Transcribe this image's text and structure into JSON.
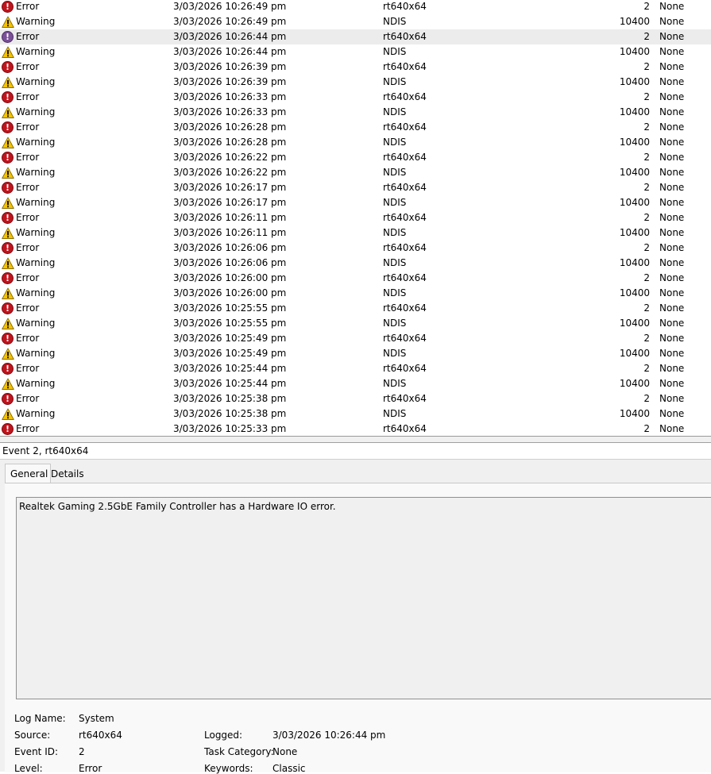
{
  "events": [
    {
      "level": "Error",
      "date": "3/03/2026 10:26:49 pm",
      "source": "rt640x64",
      "event_id": "2",
      "task": "None"
    },
    {
      "level": "Warning",
      "date": "3/03/2026 10:26:49 pm",
      "source": "NDIS",
      "event_id": "10400",
      "task": "None"
    },
    {
      "level": "Error",
      "date": "3/03/2026 10:26:44 pm",
      "source": "rt640x64",
      "event_id": "2",
      "task": "None",
      "selected": true
    },
    {
      "level": "Warning",
      "date": "3/03/2026 10:26:44 pm",
      "source": "NDIS",
      "event_id": "10400",
      "task": "None"
    },
    {
      "level": "Error",
      "date": "3/03/2026 10:26:39 pm",
      "source": "rt640x64",
      "event_id": "2",
      "task": "None"
    },
    {
      "level": "Warning",
      "date": "3/03/2026 10:26:39 pm",
      "source": "NDIS",
      "event_id": "10400",
      "task": "None"
    },
    {
      "level": "Error",
      "date": "3/03/2026 10:26:33 pm",
      "source": "rt640x64",
      "event_id": "2",
      "task": "None"
    },
    {
      "level": "Warning",
      "date": "3/03/2026 10:26:33 pm",
      "source": "NDIS",
      "event_id": "10400",
      "task": "None"
    },
    {
      "level": "Error",
      "date": "3/03/2026 10:26:28 pm",
      "source": "rt640x64",
      "event_id": "2",
      "task": "None"
    },
    {
      "level": "Warning",
      "date": "3/03/2026 10:26:28 pm",
      "source": "NDIS",
      "event_id": "10400",
      "task": "None"
    },
    {
      "level": "Error",
      "date": "3/03/2026 10:26:22 pm",
      "source": "rt640x64",
      "event_id": "2",
      "task": "None"
    },
    {
      "level": "Warning",
      "date": "3/03/2026 10:26:22 pm",
      "source": "NDIS",
      "event_id": "10400",
      "task": "None"
    },
    {
      "level": "Error",
      "date": "3/03/2026 10:26:17 pm",
      "source": "rt640x64",
      "event_id": "2",
      "task": "None"
    },
    {
      "level": "Warning",
      "date": "3/03/2026 10:26:17 pm",
      "source": "NDIS",
      "event_id": "10400",
      "task": "None"
    },
    {
      "level": "Error",
      "date": "3/03/2026 10:26:11 pm",
      "source": "rt640x64",
      "event_id": "2",
      "task": "None"
    },
    {
      "level": "Warning",
      "date": "3/03/2026 10:26:11 pm",
      "source": "NDIS",
      "event_id": "10400",
      "task": "None"
    },
    {
      "level": "Error",
      "date": "3/03/2026 10:26:06 pm",
      "source": "rt640x64",
      "event_id": "2",
      "task": "None"
    },
    {
      "level": "Warning",
      "date": "3/03/2026 10:26:06 pm",
      "source": "NDIS",
      "event_id": "10400",
      "task": "None"
    },
    {
      "level": "Error",
      "date": "3/03/2026 10:26:00 pm",
      "source": "rt640x64",
      "event_id": "2",
      "task": "None"
    },
    {
      "level": "Warning",
      "date": "3/03/2026 10:26:00 pm",
      "source": "NDIS",
      "event_id": "10400",
      "task": "None"
    },
    {
      "level": "Error",
      "date": "3/03/2026 10:25:55 pm",
      "source": "rt640x64",
      "event_id": "2",
      "task": "None"
    },
    {
      "level": "Warning",
      "date": "3/03/2026 10:25:55 pm",
      "source": "NDIS",
      "event_id": "10400",
      "task": "None"
    },
    {
      "level": "Error",
      "date": "3/03/2026 10:25:49 pm",
      "source": "rt640x64",
      "event_id": "2",
      "task": "None"
    },
    {
      "level": "Warning",
      "date": "3/03/2026 10:25:49 pm",
      "source": "NDIS",
      "event_id": "10400",
      "task": "None"
    },
    {
      "level": "Error",
      "date": "3/03/2026 10:25:44 pm",
      "source": "rt640x64",
      "event_id": "2",
      "task": "None"
    },
    {
      "level": "Warning",
      "date": "3/03/2026 10:25:44 pm",
      "source": "NDIS",
      "event_id": "10400",
      "task": "None"
    },
    {
      "level": "Error",
      "date": "3/03/2026 10:25:38 pm",
      "source": "rt640x64",
      "event_id": "2",
      "task": "None"
    },
    {
      "level": "Warning",
      "date": "3/03/2026 10:25:38 pm",
      "source": "NDIS",
      "event_id": "10400",
      "task": "None"
    },
    {
      "level": "Error",
      "date": "3/03/2026 10:25:33 pm",
      "source": "rt640x64",
      "event_id": "2",
      "task": "None"
    }
  ],
  "icons": {
    "error": "error-icon",
    "warning": "warning-icon"
  },
  "colors": {
    "error_red": "#c0141c",
    "warning_yellow": "#f5c400",
    "selected_row": "#ececec"
  },
  "detail": {
    "header": "Event 2, rt640x64",
    "tabs": {
      "general": "General",
      "details": "Details"
    },
    "message": "Realtek Gaming 2.5GbE Family Controller has a Hardware IO error.",
    "labels": {
      "log_name": "Log Name:",
      "source": "Source:",
      "event_id": "Event ID:",
      "level": "Level:",
      "logged": "Logged:",
      "task_category": "Task Category:",
      "keywords": "Keywords:"
    },
    "values": {
      "log_name": "System",
      "source": "rt640x64",
      "event_id": "2",
      "level": "Error",
      "logged": "3/03/2026 10:26:44 pm",
      "task_category": "None",
      "keywords": "Classic"
    }
  }
}
